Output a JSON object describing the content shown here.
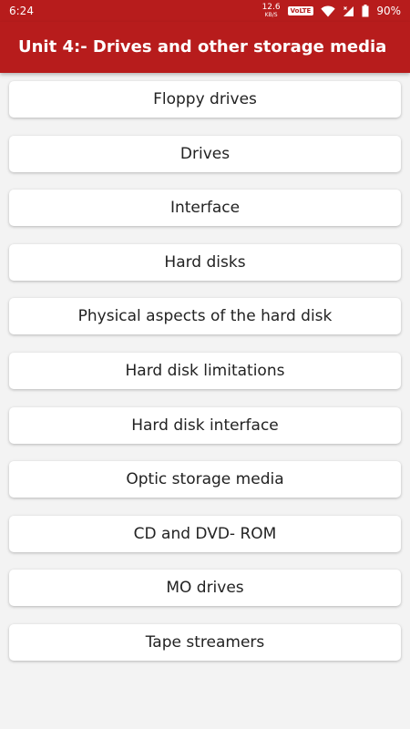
{
  "status_bar": {
    "time": "6:24",
    "net_speed_value": "12.6",
    "net_speed_unit": "KB/S",
    "volte": "VoLTE",
    "battery": "90%"
  },
  "app_bar": {
    "title": "Unit 4:- Drives and other storage media"
  },
  "topics": [
    "Floppy drives",
    "Drives",
    "Interface",
    "Hard disks",
    "Physical aspects of the hard disk",
    "Hard disk limitations",
    "Hard disk interface",
    "Optic storage media",
    "CD and DVD- ROM",
    "MO drives",
    "Tape streamers"
  ],
  "colors": {
    "primary": "#b71c1c",
    "background": "#f3f3f3",
    "card": "#ffffff"
  },
  "icons": [
    "wifi-icon",
    "signal-icon",
    "battery-icon"
  ]
}
